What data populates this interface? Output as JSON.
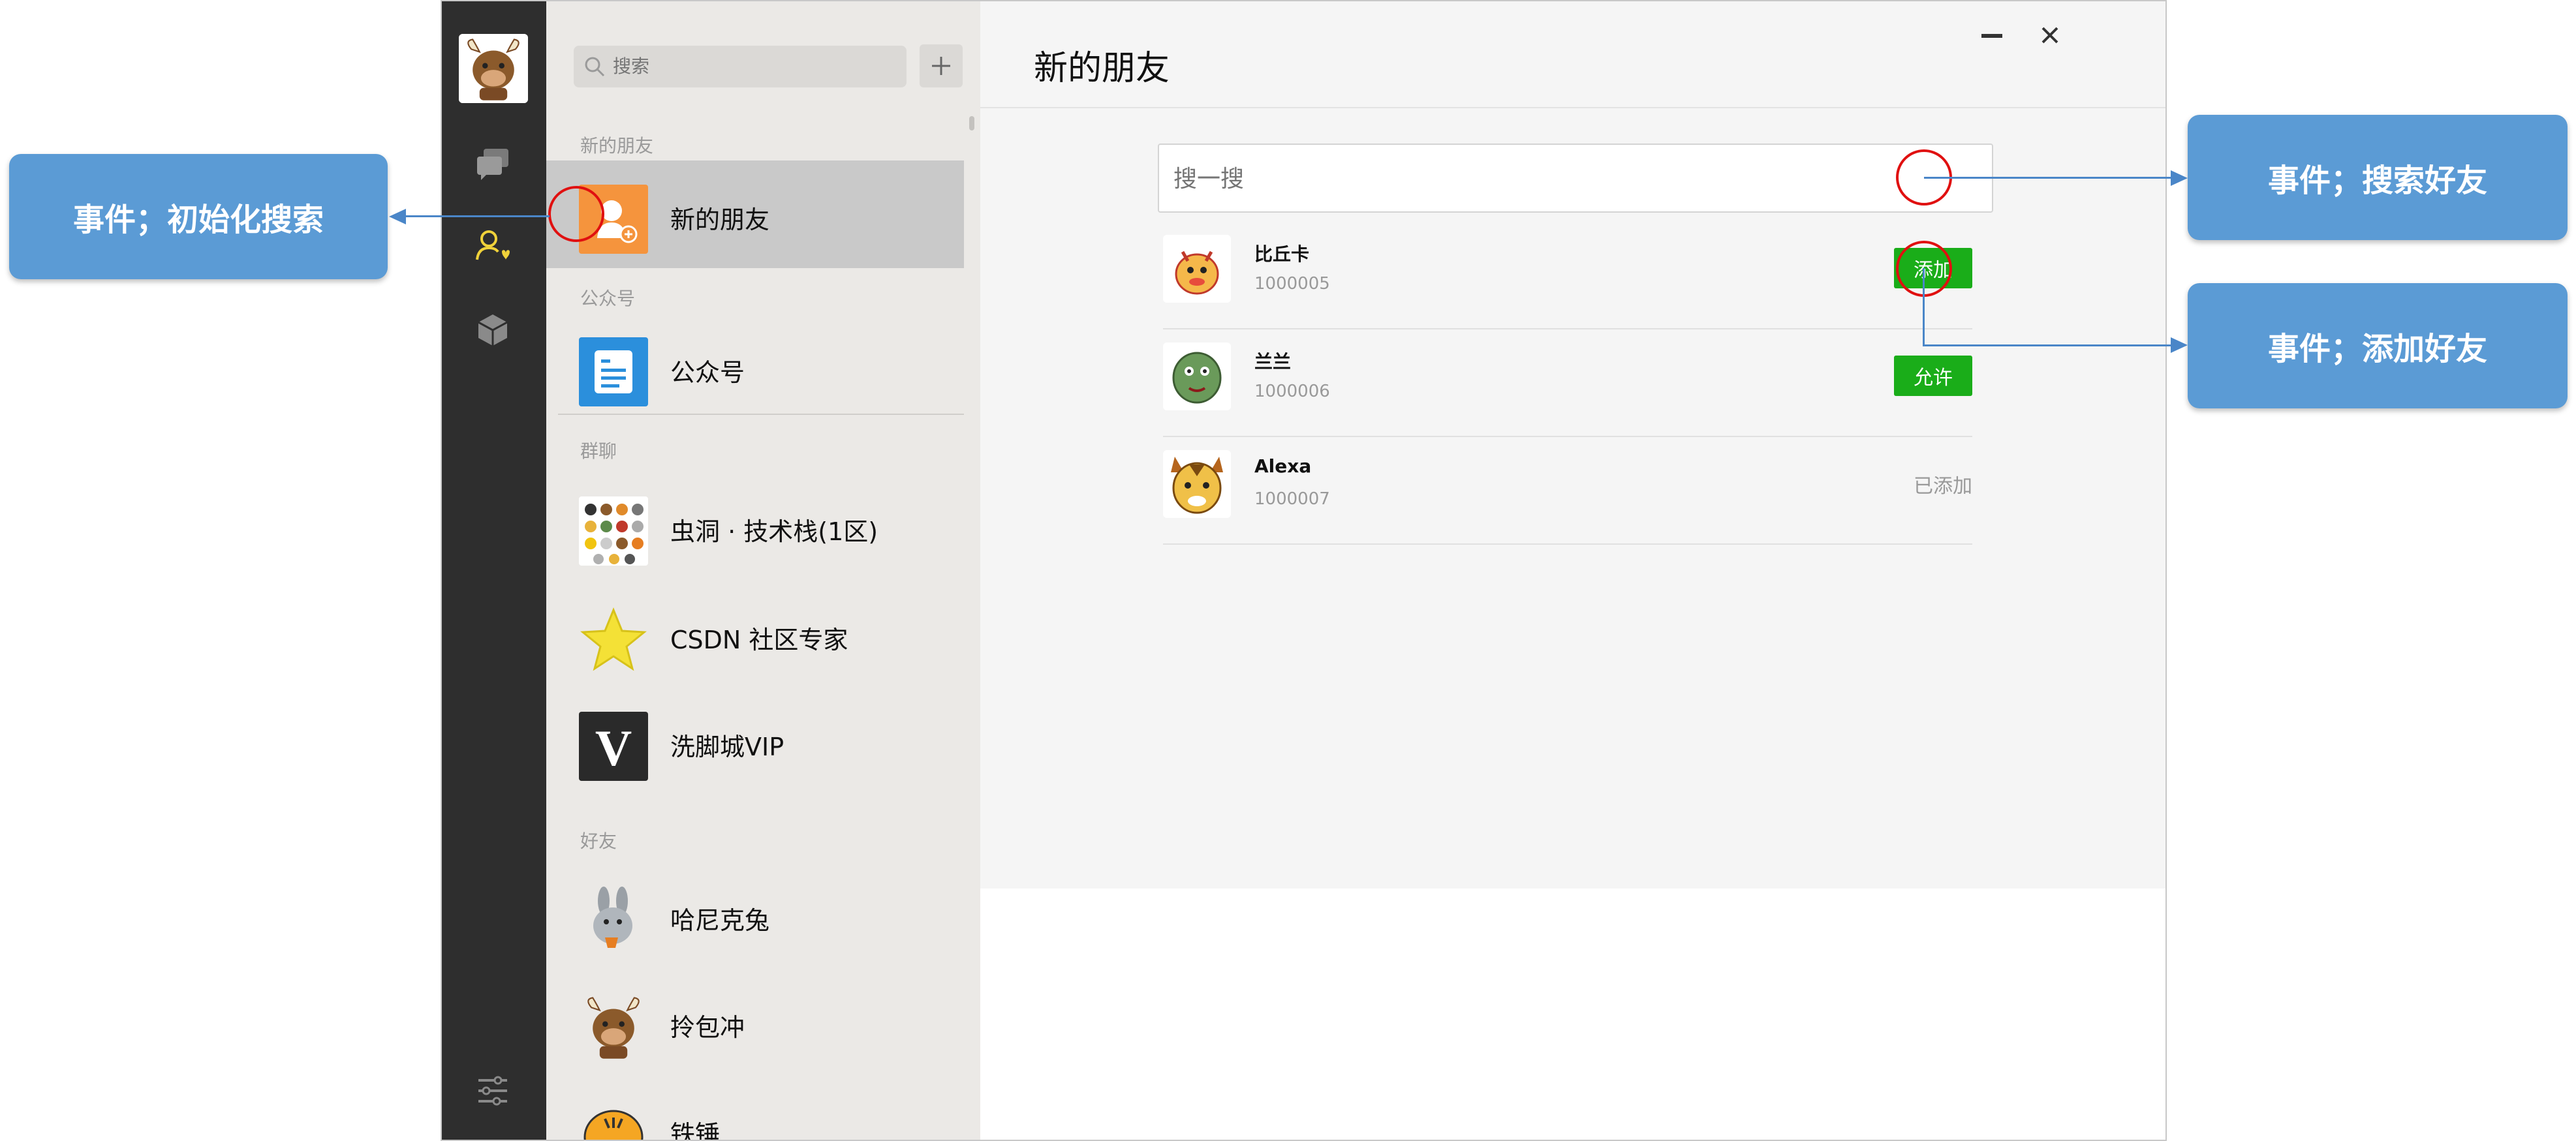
{
  "annotations": {
    "init_search": "事件；初始化搜索",
    "search_friend": "事件；搜索好友",
    "add_friend": "事件；添加好友"
  },
  "sidebar": {
    "search_placeholder": "搜索",
    "add_icon": "plus-icon",
    "sections": {
      "new_friends": "新的朋友",
      "official": "公众号",
      "groups": "群聊",
      "friends": "好友"
    },
    "items": {
      "new_friends": "新的朋友",
      "official": "公众号",
      "group1": "虫洞 · 技术栈(1区)",
      "group2": "CSDN 社区专家",
      "group3": "洗脚城VIP",
      "friend1": "哈尼克兔",
      "friend2": "拎包冲",
      "friend3": "铁锤"
    }
  },
  "main": {
    "title": "新的朋友",
    "search_placeholder": "搜一搜",
    "friends": [
      {
        "name": "比丘卡",
        "id": "1000005",
        "action": "添加"
      },
      {
        "name": "兰兰",
        "id": "1000006",
        "action": "允许"
      },
      {
        "name": "Alexa",
        "id": "1000007",
        "status": "已添加"
      }
    ]
  },
  "colors": {
    "accent_green": "#1aad19",
    "callout_blue": "#5b9bd5",
    "rail_dark": "#2e2e2e",
    "highlight_red": "#e01010"
  }
}
